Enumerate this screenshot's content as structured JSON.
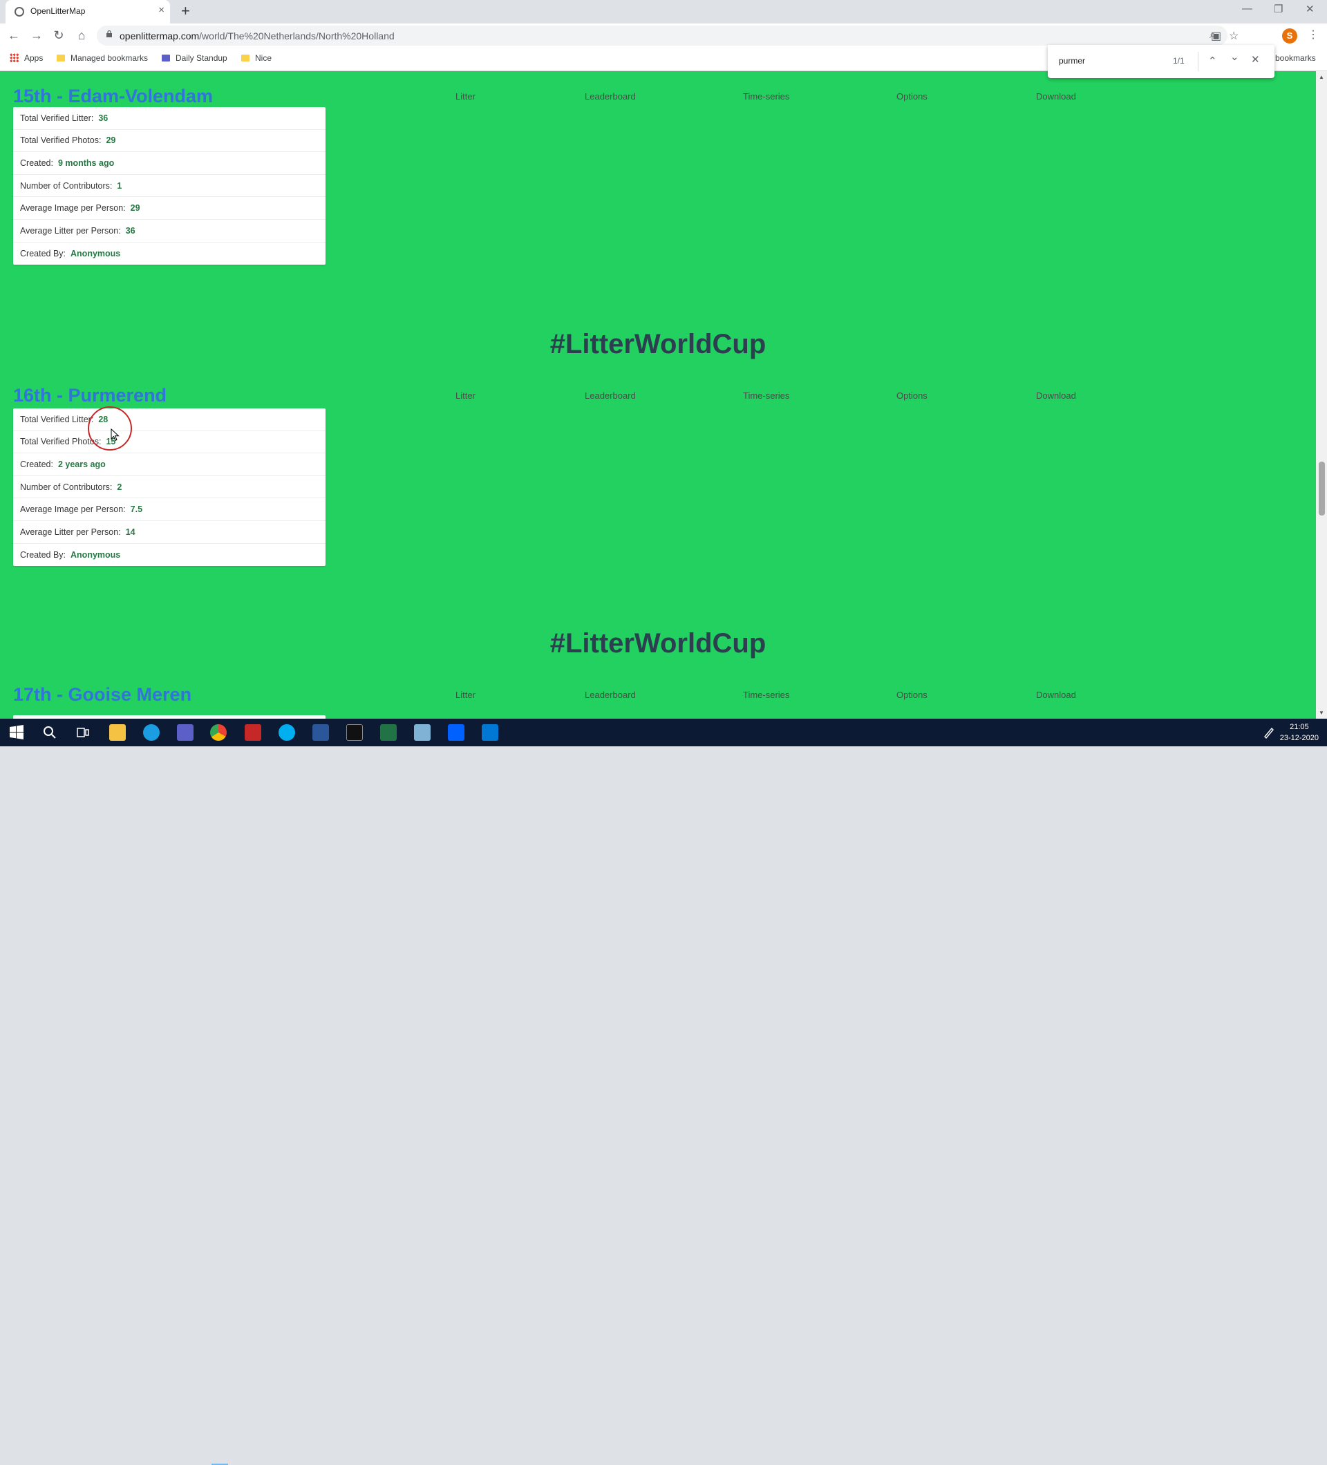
{
  "browser": {
    "tab_title": "OpenLitterMap",
    "tab_close": "×",
    "new_tab": "+",
    "url_host": "openlittermap.com",
    "url_path": "/world/The%20Netherlands/North%20Holland",
    "window_controls": {
      "minimize": "—",
      "restore": "❐",
      "close": "✕"
    },
    "nav": {
      "back": "←",
      "forward": "→",
      "reload": "↻",
      "home": "⌂"
    },
    "profile_initial": "S",
    "menu": "⋮"
  },
  "bookmarks": {
    "apps": "Apps",
    "items": [
      "Managed bookmarks",
      "Daily Standup",
      "Nice"
    ],
    "other": "bookmarks"
  },
  "find": {
    "query": "purmer",
    "count": "1/1",
    "prev": "⌃",
    "next": "⌄",
    "close": "✕"
  },
  "tabs_labels": [
    "Litter",
    "Leaderboard",
    "Time-series",
    "Options",
    "Download"
  ],
  "hashtag": "#LitterWorldCup",
  "locations": [
    {
      "title": "15th - Edam-Volendam",
      "stats": [
        {
          "label": "Total Verified Litter:",
          "value": "36"
        },
        {
          "label": "Total Verified Photos:",
          "value": "29"
        },
        {
          "label": "Created:",
          "value": "9 months ago"
        },
        {
          "label": "Number of Contributors:",
          "value": "1"
        },
        {
          "label": "Average Image per Person:",
          "value": "29"
        },
        {
          "label": "Average Litter per Person:",
          "value": "36"
        },
        {
          "label": "Created By:",
          "value": "Anonymous"
        }
      ]
    },
    {
      "title": "16th - Purmerend",
      "stats": [
        {
          "label": "Total Verified Litter:",
          "value": "28"
        },
        {
          "label": "Total Verified Photos:",
          "value": "15"
        },
        {
          "label": "Created:",
          "value": "2 years ago"
        },
        {
          "label": "Number of Contributors:",
          "value": "2"
        },
        {
          "label": "Average Image per Person:",
          "value": "7.5"
        },
        {
          "label": "Average Litter per Person:",
          "value": "14"
        },
        {
          "label": "Created By:",
          "value": "Anonymous"
        }
      ]
    },
    {
      "title": "17th - Gooise Meren",
      "stats": []
    }
  ],
  "taskbar": {
    "time": "21:05",
    "date": "23-12-2020",
    "apps": [
      "start-icon",
      "search-icon",
      "task-view-icon",
      "file-explorer-icon",
      "internet-explorer-icon",
      "teams-icon",
      "chrome-icon",
      "app-icon",
      "skype-icon",
      "word-icon",
      "terminal-icon",
      "excel-icon",
      "app-icon",
      "dropbox-icon",
      "photos-icon"
    ]
  }
}
